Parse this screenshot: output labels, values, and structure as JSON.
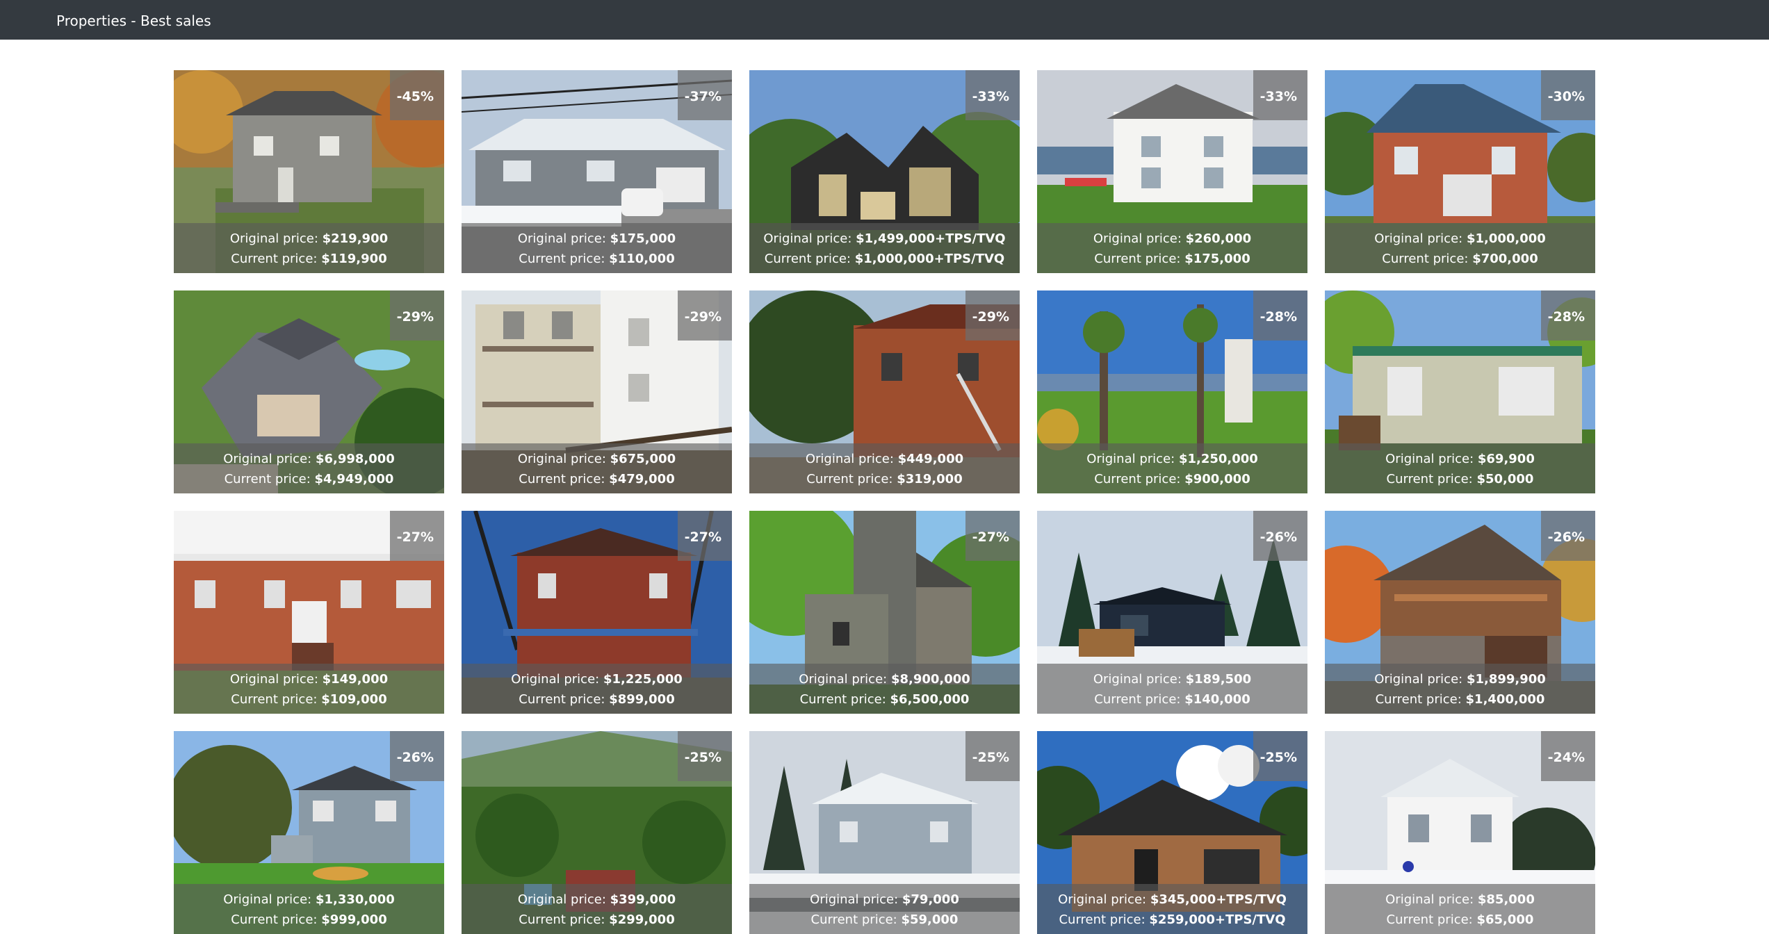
{
  "header": {
    "title": "Properties - Best sales"
  },
  "labels": {
    "original": "Original price: ",
    "current": "Current price: "
  },
  "listings": [
    {
      "discount": "-45%",
      "original_price": "$219,900",
      "current_price": "$119,900",
      "scene": "gray two-storey house with porch, autumn trees"
    },
    {
      "discount": "-37%",
      "original_price": "$175,000",
      "current_price": "$110,000",
      "scene": "bungalow with dormers, snow, white car"
    },
    {
      "discount": "-33%",
      "original_price": "$1,499,000+TPS/TVQ",
      "current_price": "$1,000,000+TPS/TVQ",
      "scene": "modern dark chalet rendering in forest"
    },
    {
      "discount": "-33%",
      "original_price": "$260,000",
      "current_price": "$175,000",
      "scene": "white farmhouse on green lawn"
    },
    {
      "discount": "-30%",
      "original_price": "$1,000,000",
      "current_price": "$700,000",
      "scene": "red brick house with blue roof"
    },
    {
      "discount": "-29%",
      "original_price": "$6,998,000",
      "current_price": "$4,949,000",
      "scene": "aerial view of stone manor with pool"
    },
    {
      "discount": "-29%",
      "original_price": "$675,000",
      "current_price": "$479,000",
      "scene": "triplex with balconies and white siding"
    },
    {
      "discount": "-29%",
      "original_price": "$449,000",
      "current_price": "$319,000",
      "scene": "brick duplex with outdoor staircase"
    },
    {
      "discount": "-28%",
      "original_price": "$1,250,000",
      "current_price": "$900,000",
      "scene": "lake view with tall trees and sign"
    },
    {
      "discount": "-28%",
      "original_price": "$69,900",
      "current_price": "$50,000",
      "scene": "beige bungalow with green trim"
    },
    {
      "discount": "-27%",
      "original_price": "$149,000",
      "current_price": "$109,000",
      "scene": "brick apartment building with stairs"
    },
    {
      "discount": "-27%",
      "original_price": "$1,225,000",
      "current_price": "$899,000",
      "scene": "red brick victorian with blue porch"
    },
    {
      "discount": "-27%",
      "original_price": "$8,900,000",
      "current_price": "$6,500,000",
      "scene": "stone castle-like house in greenery"
    },
    {
      "discount": "-26%",
      "original_price": "$189,500",
      "current_price": "$140,000",
      "scene": "dark modern cabin in snowy forest"
    },
    {
      "discount": "-26%",
      "original_price": "$1,899,900",
      "current_price": "$1,400,000",
      "scene": "wood and stone house with garage, fall colors"
    },
    {
      "discount": "-26%",
      "original_price": "$1,330,000",
      "current_price": "$999,000",
      "scene": "two-storey house with large tree"
    },
    {
      "discount": "-25%",
      "original_price": "$399,000",
      "current_price": "$299,000",
      "scene": "aerial of house in forest near hills"
    },
    {
      "discount": "-25%",
      "original_price": "$79,000",
      "current_price": "$59,000",
      "scene": "gray house on snowy street"
    },
    {
      "discount": "-25%",
      "original_price": "$345,000+TPS/TVQ",
      "current_price": "$259,000+TPS/TVQ",
      "scene": "new wood bungalow under blue sky"
    },
    {
      "discount": "-24%",
      "original_price": "$85,000",
      "current_price": "$65,000",
      "scene": "white house in heavy snow"
    }
  ],
  "colors": {
    "topbar": "#343a40",
    "overlay": "rgba(90,90,90,0.62)",
    "badge": "rgba(110,110,110,0.72)"
  }
}
